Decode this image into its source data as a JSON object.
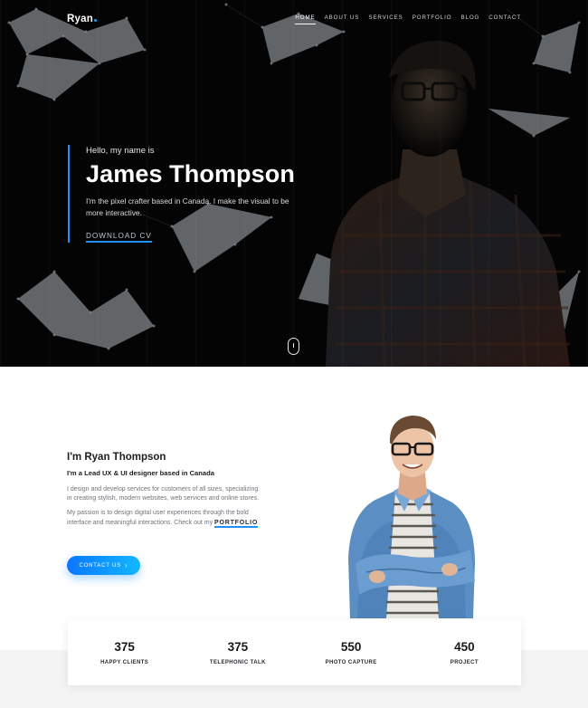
{
  "nav": {
    "logo": "Ryan",
    "items": [
      {
        "label": "HOME",
        "active": true
      },
      {
        "label": "ABOUT US",
        "active": false
      },
      {
        "label": "SERVICES",
        "active": false
      },
      {
        "label": "PORTFOLIO",
        "active": false
      },
      {
        "label": "BLOG",
        "active": false
      },
      {
        "label": "CONTACT",
        "active": false
      }
    ]
  },
  "hero": {
    "greeting": "Hello, my name is",
    "name": "James Thompson",
    "description": "I'm the pixel crafter based in Canada. I make the visual to be more interactive.",
    "cta": "DOWNLOAD CV",
    "scroll_icon": "mouse-scroll-icon"
  },
  "about": {
    "title": "I'm Ryan Thompson",
    "subtitle": "I'm a Lead UX & UI designer based in Canada",
    "paragraph1": "I design and develop services for customers of all sizes, specializing in creating stylish, modern websites, web services and online stores.",
    "paragraph2_prefix": "My passion is to design digital user experiences through the bold interface and meaningful interactions. Check out my ",
    "portfolio_link": "PORTFOLIO",
    "contact_button": "CONTACT US",
    "contact_icon": "chevron-right-icon"
  },
  "stats": [
    {
      "value": "375",
      "label": "HAPPY CLIENTS"
    },
    {
      "value": "375",
      "label": "TELEPHONIC TALK"
    },
    {
      "value": "550",
      "label": "PHOTO CAPTURE"
    },
    {
      "value": "450",
      "label": "PROJECT"
    }
  ],
  "colors": {
    "accent": "#1e90ff",
    "hero_bg": "#040404",
    "button_gradient_start": "#0b76ff",
    "button_gradient_end": "#12b7ff",
    "stats_band": "#f4f4f5"
  }
}
